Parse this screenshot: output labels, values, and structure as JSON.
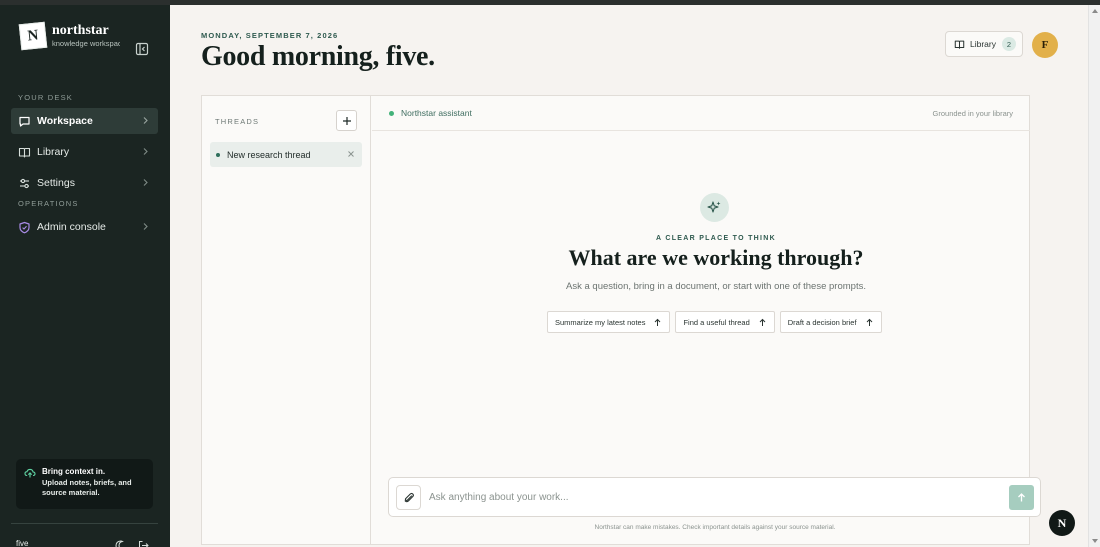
{
  "brand": {
    "name": "northstar",
    "subtitle": "knowledge workspace",
    "logo_letter": "N"
  },
  "sidebar": {
    "section_desk": "YOUR DESK",
    "section_ops": "OPERATIONS",
    "items": [
      {
        "label": "Workspace",
        "icon": "chat-icon",
        "active": true
      },
      {
        "label": "Library",
        "icon": "book-icon",
        "active": false
      },
      {
        "label": "Settings",
        "icon": "sliders-icon",
        "active": false
      },
      {
        "label": "Admin console",
        "icon": "shield-icon",
        "active": false
      }
    ],
    "context_card": {
      "title": "Bring context in.",
      "description": "Upload notes, briefs, and source material."
    },
    "user_name": "five"
  },
  "header": {
    "date": "MONDAY, SEPTEMBER 7, 2026",
    "greeting": "Good morning, five.",
    "library_label": "Library",
    "library_count": "2",
    "avatar_initial": "F"
  },
  "threads": {
    "label": "THREADS",
    "items": [
      {
        "title": "New research thread"
      }
    ]
  },
  "chat": {
    "assistant_name": "Northstar assistant",
    "grounded_label": "Grounded in your library",
    "kicker": "A CLEAR PLACE TO THINK",
    "headline": "What are we working through?",
    "subline": "Ask a question, bring in a document, or start with one of these prompts.",
    "prompts": [
      "Summarize my latest notes",
      "Find a useful thread",
      "Draft a decision brief"
    ],
    "placeholder": "Ask anything about your work...",
    "disclaimer": "Northstar can make mistakes. Check important details against your source material."
  },
  "fab_letter": "N",
  "colors": {
    "sidebar_bg": "#1b2522",
    "accent": "#2f5a4f",
    "avatar": "#e2b04a",
    "status_dot": "#43b27a"
  }
}
